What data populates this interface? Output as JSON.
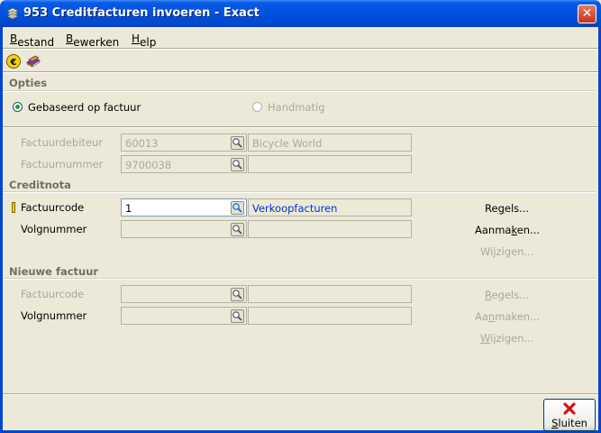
{
  "window": {
    "title": "953 Creditfacturen invoeren - Exact",
    "close_label": "✕"
  },
  "menu": [
    {
      "pre": "",
      "ul": "B",
      "post": "estand"
    },
    {
      "pre": "",
      "ul": "B",
      "post": "ewerken"
    },
    {
      "pre": "",
      "ul": "H",
      "post": "elp"
    }
  ],
  "opties": {
    "title": "Opties",
    "option1": "Gebaseerd op factuur",
    "option2": "Handmatig",
    "selected": "option1"
  },
  "factuur": {
    "debiteur_label": "Factuurdebiteur",
    "debiteur_value": "60013",
    "debiteur_desc": "Bicycle World",
    "nummer_label": "Factuurnummer",
    "nummer_value": "9700038",
    "nummer_desc": ""
  },
  "creditnota": {
    "title": "Creditnota",
    "code_label": "Factuurcode",
    "code_value": "1",
    "code_desc": "Verkoopfacturen",
    "volg_label": "Volgnummer",
    "volg_value": "",
    "volg_desc": "",
    "regels": {
      "pre": "Re",
      "ul": "g",
      "post": "els..."
    },
    "aanmaken": {
      "pre": "Aanma",
      "ul": "k",
      "post": "en..."
    },
    "wijzigen": {
      "pre": "Wi",
      "ul": "j",
      "post": "zigen..."
    }
  },
  "nieuwe": {
    "title": "Nieuwe factuur",
    "code_label": "Factuurcode",
    "code_value": "",
    "code_desc": "",
    "volg_label": "Volgnummer",
    "volg_value": "",
    "volg_desc": "",
    "regels": {
      "pre": "",
      "ul": "R",
      "post": "egels..."
    },
    "aanmaken": {
      "pre": "Aa",
      "ul": "n",
      "post": "maken..."
    },
    "wijzigen": {
      "pre": "",
      "ul": "W",
      "post": "ijzigen..."
    }
  },
  "footer": {
    "sluiten": {
      "pre": "",
      "ul": "S",
      "post": "luiten"
    }
  },
  "colors": {
    "title_bar": "#0052e0",
    "link": "#0033cc",
    "disabled": "#aca899",
    "required": "#f5d000"
  }
}
